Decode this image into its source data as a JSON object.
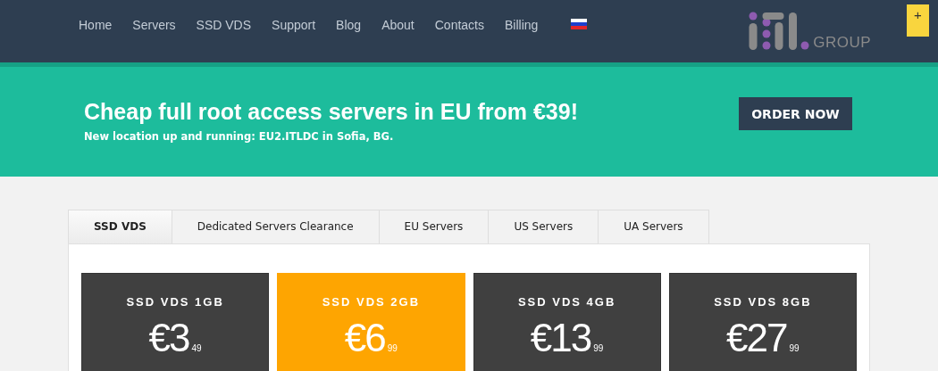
{
  "nav": [
    {
      "kind": "link",
      "label": "Home"
    },
    {
      "kind": "link",
      "label": "Servers"
    },
    {
      "kind": "link",
      "label": "SSD VDS"
    },
    {
      "kind": "link",
      "label": "Support"
    },
    {
      "kind": "link",
      "label": "Blog"
    },
    {
      "kind": "link",
      "label": "About"
    },
    {
      "kind": "link",
      "label": "Contacts"
    },
    {
      "kind": "link",
      "label": "Billing"
    },
    {
      "kind": "flag"
    }
  ],
  "logo": {
    "suffix": "GROUP"
  },
  "corner_tab": {
    "label": "+"
  },
  "banner": {
    "heading": "Cheap full root access servers in EU from €39!",
    "subheading": "New location up and running: EU2.ITLDC in Sofia, BG.",
    "button": "ORDER NOW"
  },
  "tabs": [
    {
      "label": "SSD VDS",
      "selected": true
    },
    {
      "label": "Dedicated Servers Clearance",
      "selected": false
    },
    {
      "label": "EU Servers",
      "selected": false
    },
    {
      "label": "US Servers",
      "selected": false
    },
    {
      "label": "UA Servers",
      "selected": false
    }
  ],
  "plans": [
    {
      "title": "SSD VDS 1GB",
      "price": "€3",
      "cents": "49",
      "highlighted": false
    },
    {
      "title": "SSD VDS 2GB",
      "price": "€6",
      "cents": "99",
      "highlighted": true
    },
    {
      "title": "SSD VDS 4GB",
      "price": "€13",
      "cents": "99",
      "highlighted": false
    },
    {
      "title": "SSD VDS 8GB",
      "price": "€27",
      "cents": "99",
      "highlighted": false
    }
  ]
}
